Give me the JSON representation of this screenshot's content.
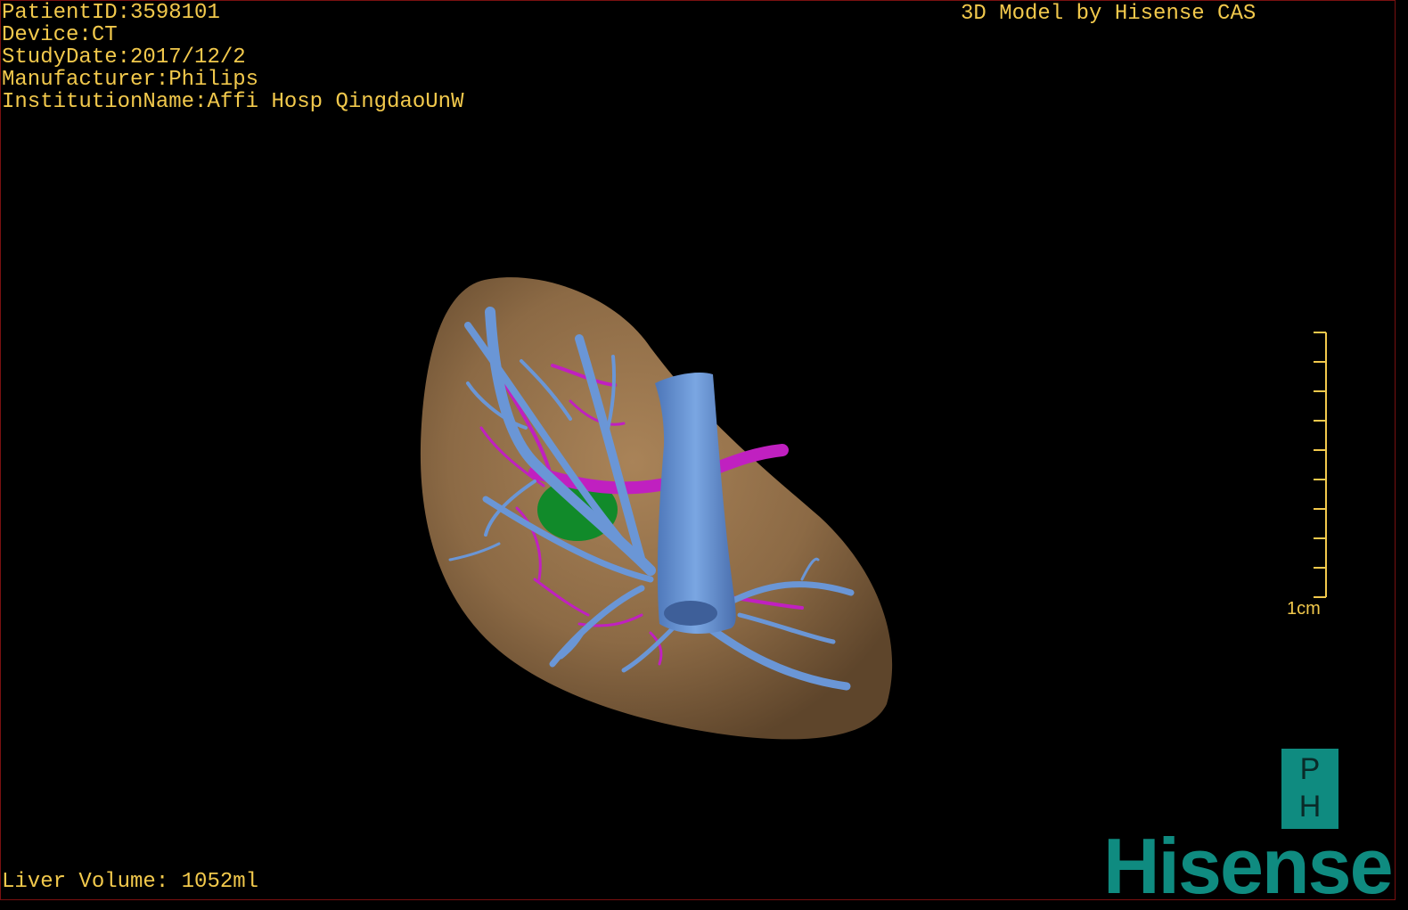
{
  "info": {
    "patient_id": "PatientID:3598101",
    "device": "Device:CT",
    "study_date": "StudyDate:2017/12/2",
    "manufacturer": "Manufacturer:Philips",
    "institution": "InstitutionName:Affi Hosp QingdaoUnW"
  },
  "title": "3D Model by Hisense CAS",
  "liver_volume": "Liver Volume: 1052ml",
  "scale_bar": {
    "label": "1cm",
    "ticks": 10
  },
  "logo": {
    "ph_top": "P",
    "ph_bottom": "H",
    "brand": "Hisense"
  },
  "colors": {
    "text": "#f2c94c",
    "liver": "#8c6a45",
    "portal_vein": "#6a96d6",
    "hepatic_artery": "#c020c0",
    "gallbladder": "#118a2a",
    "brand": "#0f8b80"
  }
}
